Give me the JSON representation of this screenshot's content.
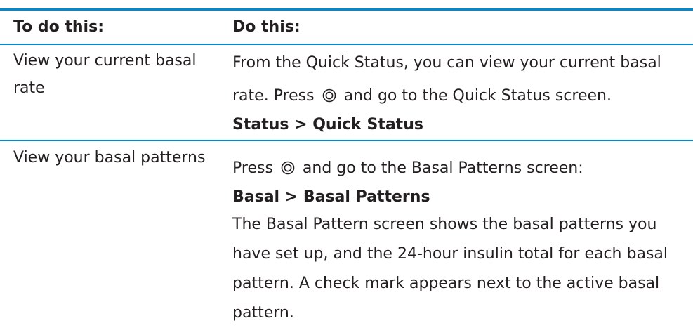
{
  "table": {
    "headers": [
      "To do this:",
      "Do this:"
    ],
    "rows": [
      {
        "task": [
          "View your current basal",
          "rate"
        ],
        "steps": [
          "From the Quick Status, you can view your current basal",
          {
            "before": "rate. Press",
            "after": "and go to the Quick Status screen."
          },
          "Status > Quick Status"
        ]
      },
      {
        "task": [
          "View your basal patterns"
        ],
        "steps": [
          {
            "before": "Press",
            "after": "and go to the Basal Patterns screen:"
          },
          "Basal > Basal Patterns",
          "The Basal Pattern screen shows the basal patterns you",
          "have set up, and the 24-hour insulin total for each basal",
          "pattern. A check mark appears next to the active basal",
          "pattern."
        ]
      }
    ]
  },
  "icons": {
    "select_button": "select-button-icon"
  },
  "colors": {
    "accent": "#0089cf",
    "text": "#231f20"
  }
}
